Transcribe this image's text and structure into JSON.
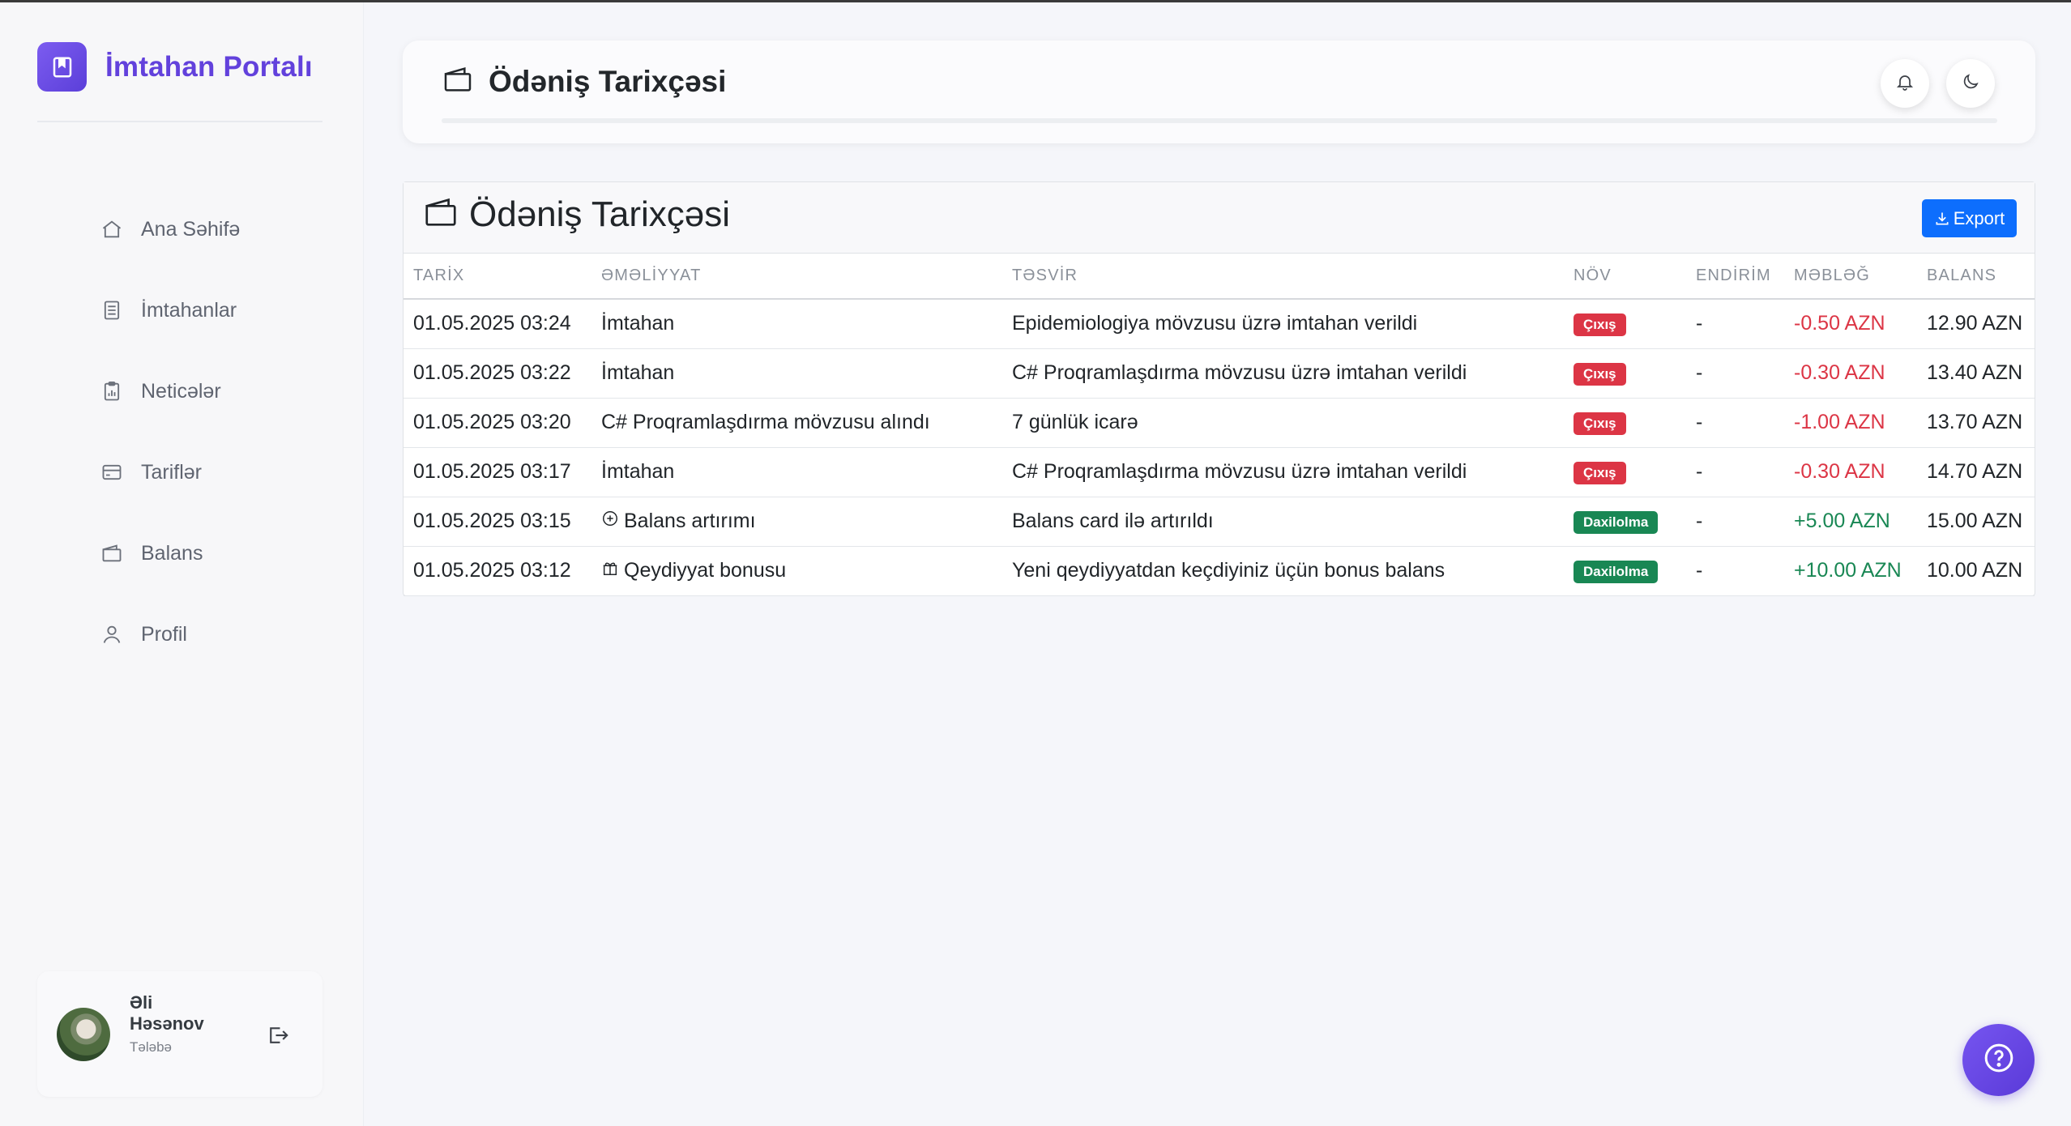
{
  "app": {
    "title": "İmtahan Portalı"
  },
  "sidebar": {
    "items": [
      {
        "label": "Ana Səhifə",
        "icon": "home-icon"
      },
      {
        "label": "İmtahanlar",
        "icon": "document-list-icon"
      },
      {
        "label": "Neticələr",
        "icon": "clipboard-chart-icon"
      },
      {
        "label": "Tariflər",
        "icon": "credit-card-icon"
      },
      {
        "label": "Balans",
        "icon": "wallet-icon"
      },
      {
        "label": "Profil",
        "icon": "user-icon"
      }
    ]
  },
  "user": {
    "first_name": "Əli",
    "last_name": "Həsənov",
    "role": "Tələbə"
  },
  "header": {
    "title": "Ödəniş Tarixçəsi"
  },
  "card": {
    "title": "Ödəniş Tarixçəsi",
    "export_label": "Export"
  },
  "table": {
    "columns": [
      "TARİX",
      "ƏMƏLİYYAT",
      "TƏSVİR",
      "NÖV",
      "ENDİRİM",
      "MƏBLƏĞ",
      "BALANS"
    ],
    "rows": [
      {
        "date": "01.05.2025 03:24",
        "operation": "İmtahan",
        "op_icon": "",
        "description": "Epidemiologiya mövzusu üzrə imtahan verildi",
        "type": "Çıxış",
        "discount": "-",
        "amount": "-0.50 AZN",
        "balance": "12.90 AZN"
      },
      {
        "date": "01.05.2025 03:22",
        "operation": "İmtahan",
        "op_icon": "",
        "description": "C# Proqramlaşdırma mövzusu üzrə imtahan verildi",
        "type": "Çıxış",
        "discount": "-",
        "amount": "-0.30 AZN",
        "balance": "13.40 AZN"
      },
      {
        "date": "01.05.2025 03:20",
        "operation": "C# Proqramlaşdırma mövzusu alındı",
        "op_icon": "",
        "description": "7 günlük icarə",
        "type": "Çıxış",
        "discount": "-",
        "amount": "-1.00 AZN",
        "balance": "13.70 AZN"
      },
      {
        "date": "01.05.2025 03:17",
        "operation": "İmtahan",
        "op_icon": "",
        "description": "C# Proqramlaşdırma mövzusu üzrə imtahan verildi",
        "type": "Çıxış",
        "discount": "-",
        "amount": "-0.30 AZN",
        "balance": "14.70 AZN"
      },
      {
        "date": "01.05.2025 03:15",
        "operation": "Balans artırımı",
        "op_icon": "plus-circle-icon",
        "description": "Balans card ilə artırıldı",
        "type": "Daxilolma",
        "discount": "-",
        "amount": "+5.00 AZN",
        "balance": "15.00 AZN"
      },
      {
        "date": "01.05.2025 03:12",
        "operation": "Qeydiyyat bonusu",
        "op_icon": "gift-icon",
        "description": "Yeni qeydiyyatdan keçdiyiniz üçün bonus balans",
        "type": "Daxilolma",
        "discount": "-",
        "amount": "+10.00 AZN",
        "balance": "10.00 AZN"
      }
    ]
  },
  "colors": {
    "brand": "#6241dc",
    "primary_button": "#0d6efd",
    "out_badge": "#dc3545",
    "in_badge": "#198754",
    "negative_amount": "#dc3545",
    "positive_amount": "#198754"
  }
}
